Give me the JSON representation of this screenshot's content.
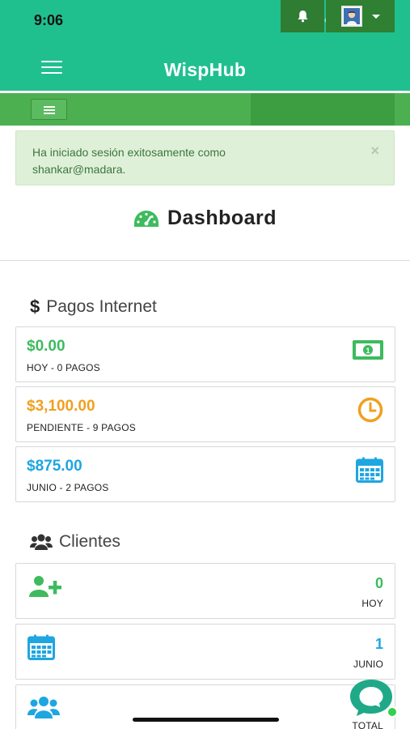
{
  "status_bar": {
    "time": "9:06"
  },
  "header": {
    "title": "WispHub"
  },
  "alert": {
    "message_line1": "Ha iniciado sesión exitosamente como",
    "message_line2": "shankar@madara.",
    "close": "×"
  },
  "dashboard": {
    "title": "Dashboard"
  },
  "pagos": {
    "title": "Pagos Internet",
    "icon": "$",
    "cards": [
      {
        "amount": "$0.00",
        "label": "HOY - 0 PAGOS",
        "color": "#3dbb5e",
        "icon": "money-icon"
      },
      {
        "amount": "$3,100.00",
        "label": "PENDIENTE - 9 PAGOS",
        "color": "#f0a020",
        "icon": "clock-icon"
      },
      {
        "amount": "$875.00",
        "label": "JUNIO - 2 PAGOS",
        "color": "#1ea6e0",
        "icon": "calendar-icon"
      }
    ]
  },
  "clientes": {
    "title": "Clientes",
    "cards": [
      {
        "value": "0",
        "label": "HOY",
        "color": "#3dbb5e",
        "icon": "user-plus-icon"
      },
      {
        "value": "1",
        "label": "JUNIO",
        "color": "#1ea6e0",
        "icon": "calendar-icon"
      },
      {
        "value": "",
        "label": "TOTAL",
        "color": "#1ea6e0",
        "icon": "users-icon"
      }
    ]
  },
  "colors": {
    "brand": "#1fc08e",
    "navbar": "#4caf50",
    "alert_bg": "#dff0d8"
  }
}
